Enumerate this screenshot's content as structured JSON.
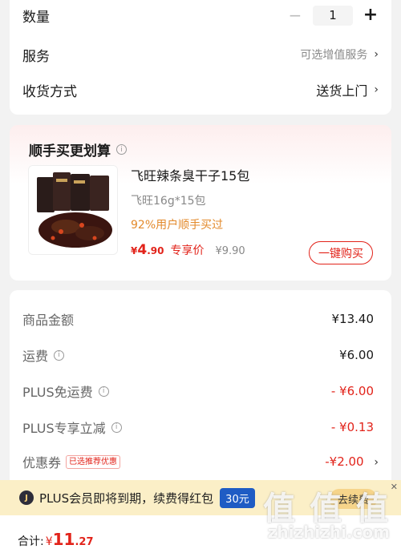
{
  "quantity": {
    "label": "数量",
    "value": "1",
    "minus": "−",
    "plus": "+"
  },
  "service": {
    "label": "服务",
    "value": "可选增值服务"
  },
  "shipping": {
    "label": "收货方式",
    "value": "送货上门"
  },
  "chevron": "›",
  "addon": {
    "title": "顺手买更划算",
    "product": {
      "name": "飞旺辣条臭干子15包",
      "spec": "飞旺16g*15包",
      "hot": "92%用户顺手买过",
      "price_symbol": "¥",
      "price_int": "4",
      "price_dec": ".90",
      "price_tag": "专享价",
      "price_orig": "¥9.90",
      "buy_label": "一键购买"
    }
  },
  "summary": {
    "goods": {
      "label": "商品金额",
      "value": "¥13.40"
    },
    "freight": {
      "label": "运费",
      "value": "¥6.00"
    },
    "plus_freight": {
      "label": "PLUS免运费",
      "value": "- ¥6.00"
    },
    "plus_discount": {
      "label": "PLUS专享立减",
      "value": "- ¥0.13"
    },
    "coupon": {
      "label": "优惠券",
      "tag": "已选推荐优惠",
      "value": "-¥2.00"
    }
  },
  "plus_banner": {
    "logo": "J",
    "text": "PLUS会员即将到期，续费得红包",
    "amount": "30元",
    "renew": "去续费",
    "close": "✕"
  },
  "bottom": {
    "total_label": "合计:",
    "currency": "¥",
    "total_int": "11",
    "total_dec": ".27"
  },
  "watermark": {
    "logo": "值 值 值",
    "url": "zhizhizhi.com"
  },
  "colors": {
    "accent": "#e2231a",
    "hot": "#e38a2c",
    "plus_bg": "#fbefc7",
    "plus_blue": "#1f5cc4"
  }
}
